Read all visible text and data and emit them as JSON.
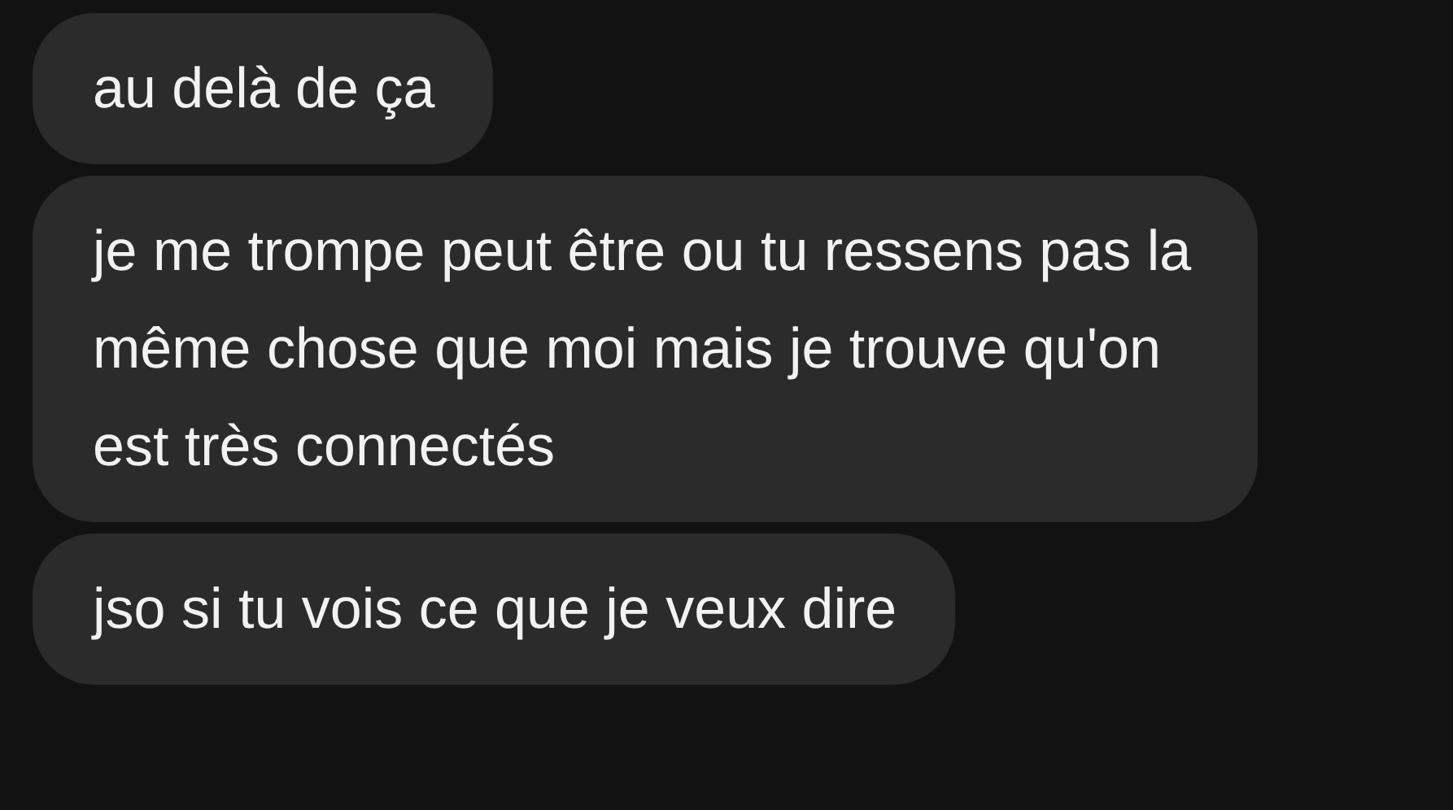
{
  "messages": [
    {
      "text": "au delà de ça"
    },
    {
      "text": "je me trompe peut être ou tu ressens pas la même chose que moi mais je trouve qu'on est très connectés"
    },
    {
      "text": "jso si tu vois ce que je veux dire"
    }
  ]
}
